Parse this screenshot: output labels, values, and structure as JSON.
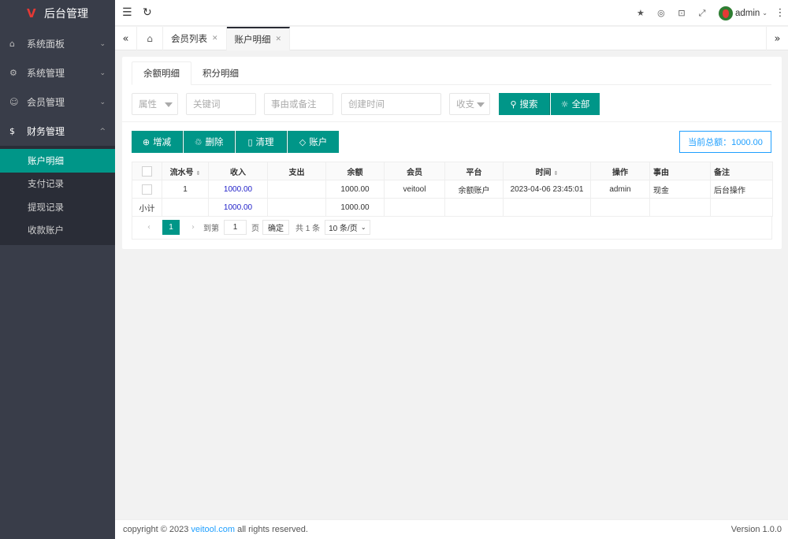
{
  "app": {
    "title": "后台管理"
  },
  "sidebar": {
    "items": [
      {
        "label": "系统面板",
        "icon": "home-icon"
      },
      {
        "label": "系统管理",
        "icon": "gear-icon"
      },
      {
        "label": "会员管理",
        "icon": "user-icon"
      },
      {
        "label": "财务管理",
        "icon": "dollar-icon"
      }
    ],
    "submenu": [
      "账户明细",
      "支付记录",
      "提现记录",
      "收款账户"
    ],
    "active_sub": "账户明细"
  },
  "header": {
    "username": "admin"
  },
  "tabs": [
    {
      "label": "会员列表"
    },
    {
      "label": "账户明细"
    }
  ],
  "inner_tabs": [
    "余额明细",
    "积分明细"
  ],
  "filters": {
    "attr_placeholder": "属性",
    "keyword_placeholder": "关键词",
    "reason_placeholder": "事由或备注",
    "time_placeholder": "创建时间",
    "inout_placeholder": "收支",
    "search_label": "搜索",
    "all_label": "全部"
  },
  "toolbar": {
    "adjust_label": "增减",
    "delete_label": "删除",
    "clear_label": "清理",
    "account_label": "账户",
    "total_label": "当前总额：1000.00"
  },
  "table": {
    "headers": [
      "流水号",
      "收入",
      "支出",
      "余额",
      "会员",
      "平台",
      "时间",
      "操作",
      "事由",
      "备注"
    ],
    "rows": [
      {
        "id": "1",
        "income": "1000.00",
        "expense": "",
        "balance": "1000.00",
        "member": "veitool",
        "platform": "余额账户",
        "time": "2023-04-06 23:45:01",
        "operator": "admin",
        "reason": "现金",
        "note": "后台操作"
      }
    ],
    "subtotal": {
      "label": "小计",
      "income": "1000.00",
      "balance": "1000.00"
    }
  },
  "pager": {
    "current": "1",
    "goto_label": "到第",
    "goto_value": "1",
    "page_label": "页",
    "confirm_label": "确定",
    "total_label": "共 1 条",
    "size_label": "10 条/页"
  },
  "footer": {
    "copyright_prefix": "copyright © 2023 ",
    "link": "veitool.com",
    "copyright_suffix": " all rights reserved.",
    "version": "Version 1.0.0"
  },
  "colors": {
    "primary": "#009688",
    "sidebar": "#393d49",
    "info": "#1e9fff"
  }
}
